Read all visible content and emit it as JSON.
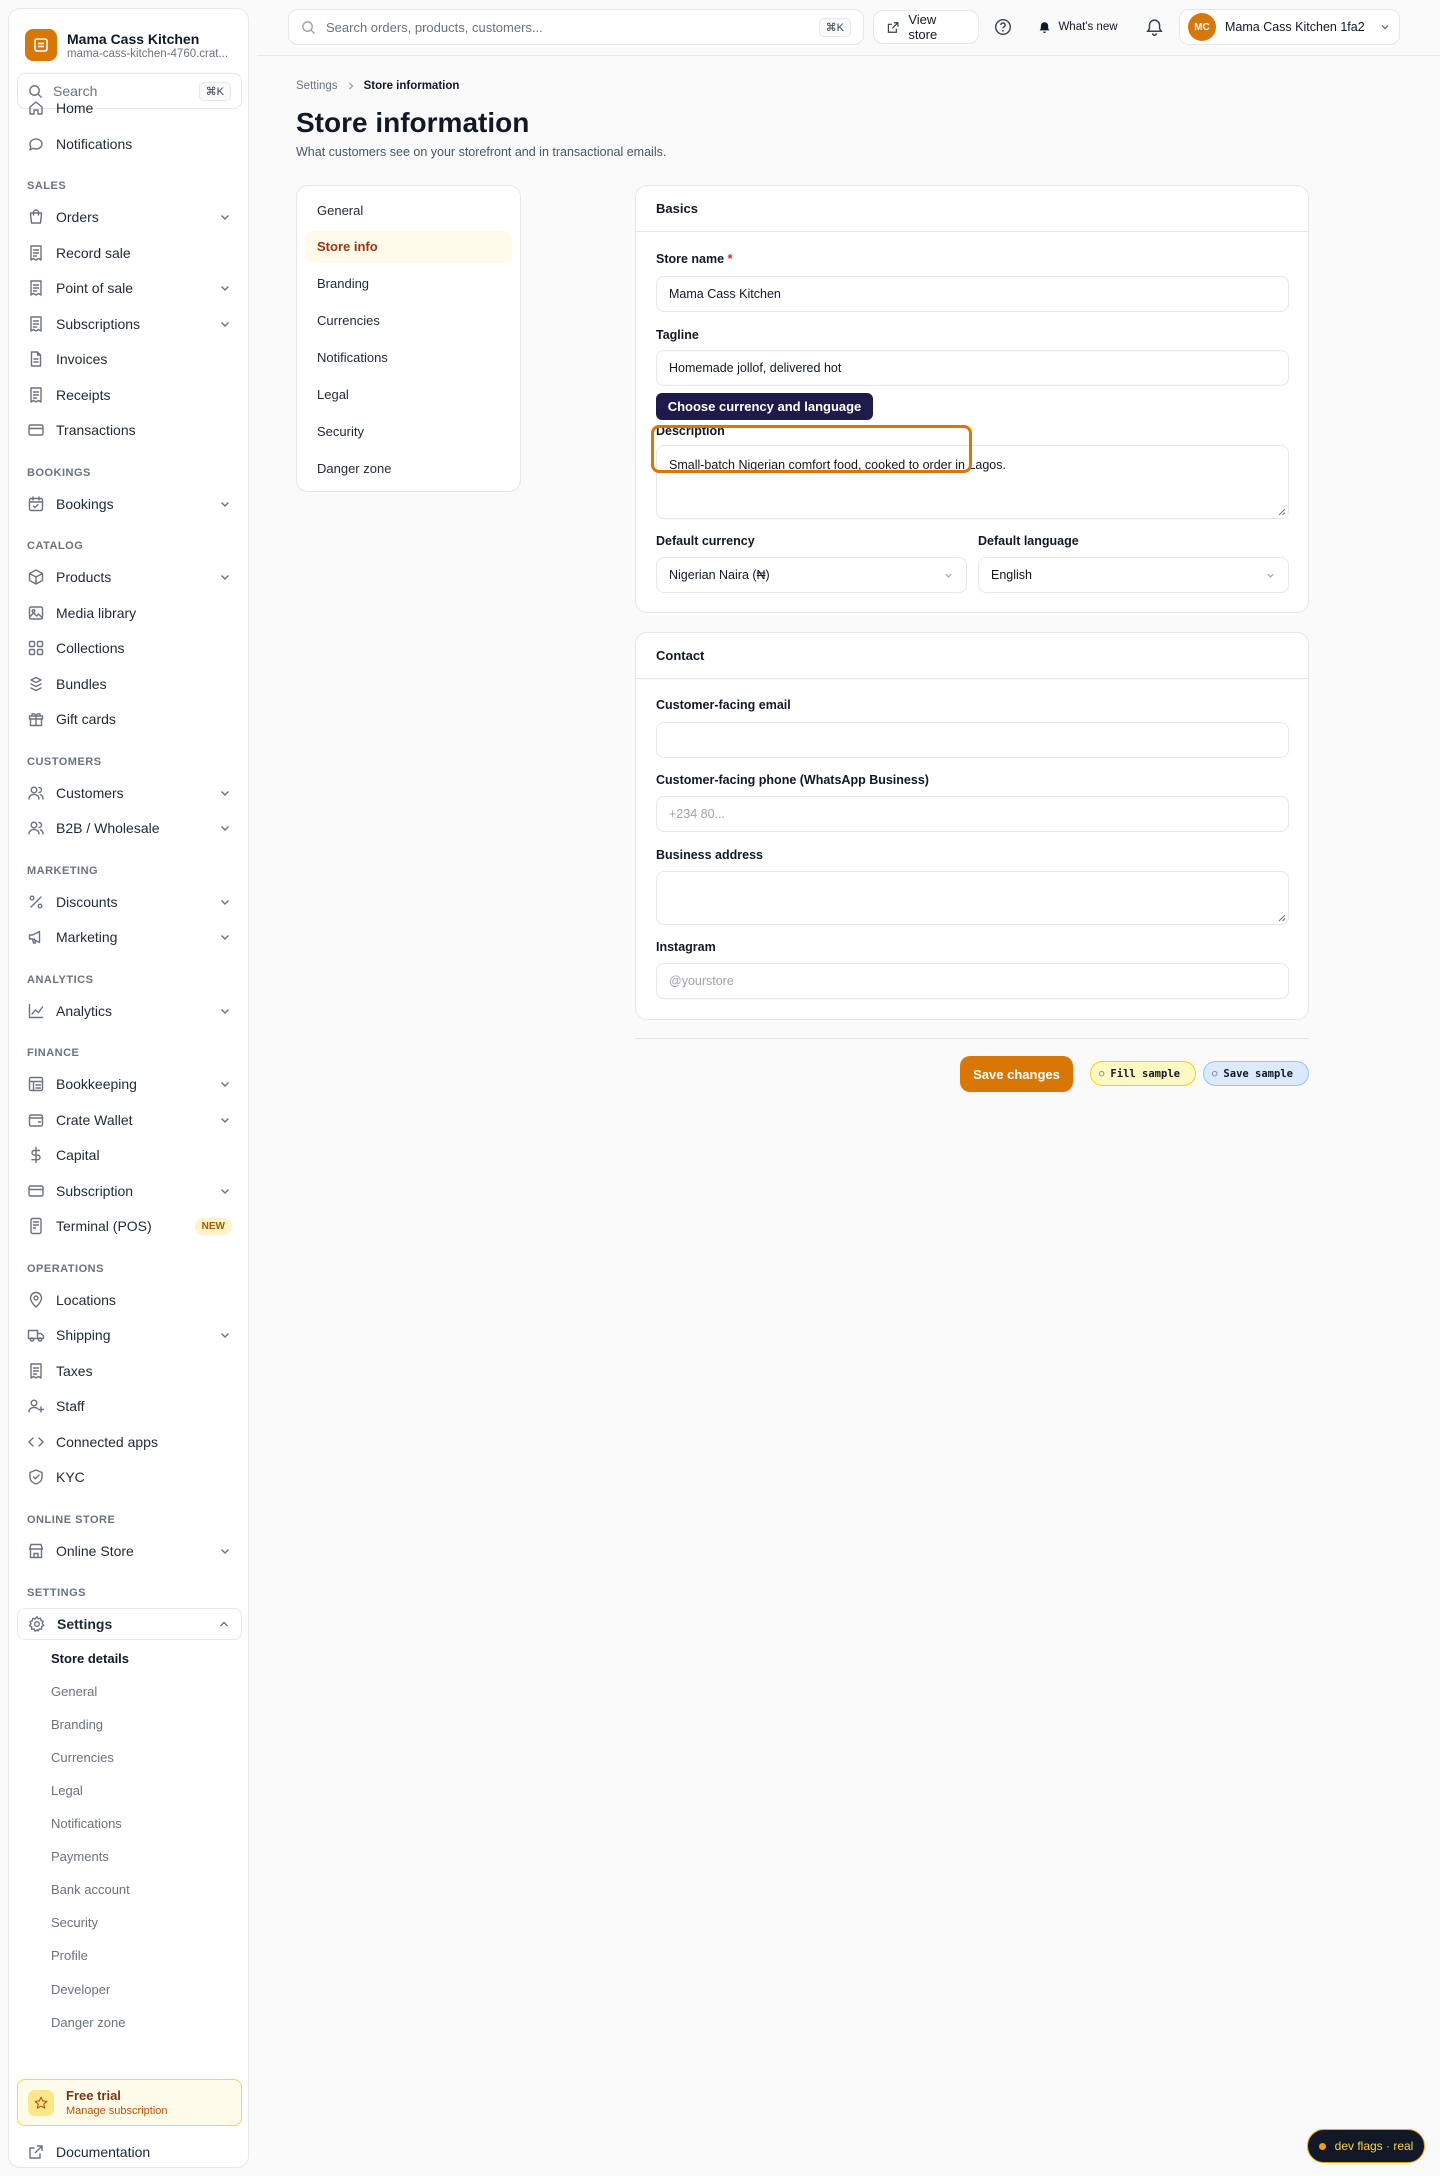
{
  "brand": {
    "name": "Mama Cass Kitchen",
    "subdomain": "mama-cass-kitchen-4760.crat..."
  },
  "sidebar": {
    "search": {
      "label": "Search",
      "shortcut": "⌘K"
    },
    "top_items": [
      {
        "label": "Home",
        "icon": "home-icon"
      },
      {
        "label": "Notifications",
        "icon": "chat-bubble-icon"
      }
    ],
    "sections": [
      {
        "title": "SALES",
        "items": [
          {
            "label": "Orders",
            "icon": "bag-icon",
            "expandable": true
          },
          {
            "label": "Record sale",
            "icon": "receipt-icon",
            "expandable": false
          },
          {
            "label": "Point of sale",
            "icon": "receipt-icon",
            "expandable": true
          },
          {
            "label": "Subscriptions",
            "icon": "receipt-icon",
            "expandable": true
          },
          {
            "label": "Invoices",
            "icon": "document-icon",
            "expandable": false
          },
          {
            "label": "Receipts",
            "icon": "receipt-icon",
            "expandable": false
          },
          {
            "label": "Transactions",
            "icon": "card-icon",
            "expandable": false
          }
        ]
      },
      {
        "title": "BOOKINGS",
        "items": [
          {
            "label": "Bookings",
            "icon": "calendar-icon",
            "expandable": true
          }
        ]
      },
      {
        "title": "CATALOG",
        "items": [
          {
            "label": "Products",
            "icon": "box-icon",
            "expandable": true
          },
          {
            "label": "Media library",
            "icon": "image-icon",
            "expandable": false
          },
          {
            "label": "Collections",
            "icon": "grid-icon",
            "expandable": false
          },
          {
            "label": "Bundles",
            "icon": "bundle-icon",
            "expandable": false
          },
          {
            "label": "Gift cards",
            "icon": "gift-icon",
            "expandable": false
          }
        ]
      },
      {
        "title": "CUSTOMERS",
        "items": [
          {
            "label": "Customers",
            "icon": "users-icon",
            "expandable": true
          },
          {
            "label": "B2B / Wholesale",
            "icon": "users-icon",
            "expandable": true
          }
        ]
      },
      {
        "title": "MARKETING",
        "items": [
          {
            "label": "Discounts",
            "icon": "percent-icon",
            "expandable": true
          },
          {
            "label": "Marketing",
            "icon": "megaphone-icon",
            "expandable": true
          }
        ]
      },
      {
        "title": "ANALYTICS",
        "items": [
          {
            "label": "Analytics",
            "icon": "chart-line-icon",
            "expandable": true
          }
        ]
      },
      {
        "title": "FINANCE",
        "items": [
          {
            "label": "Bookkeeping",
            "icon": "ledger-icon",
            "expandable": true
          },
          {
            "label": "Crate Wallet",
            "icon": "wallet-icon",
            "expandable": true
          },
          {
            "label": "Capital",
            "icon": "dollar-icon",
            "expandable": false
          },
          {
            "label": "Subscription",
            "icon": "card-icon",
            "expandable": true
          },
          {
            "label": "Terminal (POS)",
            "icon": "terminal-icon",
            "expandable": false,
            "badge": "NEW"
          }
        ]
      },
      {
        "title": "OPERATIONS",
        "items": [
          {
            "label": "Locations",
            "icon": "pin-icon",
            "expandable": false
          },
          {
            "label": "Shipping",
            "icon": "truck-icon",
            "expandable": true
          },
          {
            "label": "Taxes",
            "icon": "receipt-icon",
            "expandable": false
          },
          {
            "label": "Staff",
            "icon": "user-plus-icon",
            "expandable": false
          },
          {
            "label": "Connected apps",
            "icon": "code-icon",
            "expandable": false
          },
          {
            "label": "KYC",
            "icon": "shield-icon",
            "expandable": false
          }
        ]
      },
      {
        "title": "ONLINE STORE",
        "items": [
          {
            "label": "Online Store",
            "icon": "store-icon",
            "expandable": true
          }
        ]
      },
      {
        "title": "SETTINGS",
        "items": [
          {
            "label": "Settings",
            "icon": "gear-icon",
            "expandable": true,
            "expanded": true
          }
        ]
      }
    ],
    "settings_sub": [
      "Store details",
      "General",
      "Branding",
      "Currencies",
      "Legal",
      "Notifications",
      "Payments",
      "Bank account",
      "Security",
      "Profile",
      "Developer",
      "Danger zone"
    ],
    "trial": {
      "title": "Free trial",
      "subtitle": "Manage subscription"
    },
    "documentation": "Documentation"
  },
  "topbar": {
    "search_placeholder": "Search orders, products, customers...",
    "search_shortcut": "⌘K",
    "view_store": "View store",
    "whats_new": "What's new",
    "account_initials": "MC",
    "account_name": "Mama Cass Kitchen 1fa2"
  },
  "page": {
    "breadcrumb": [
      "Settings",
      "Store information"
    ],
    "title": "Store information",
    "subtitle": "What customers see on your storefront and in transactional emails.",
    "subnav": [
      "General",
      "Store info",
      "Branding",
      "Currencies",
      "Notifications",
      "Legal",
      "Security",
      "Danger zone"
    ],
    "subnav_active": "Store info"
  },
  "basics": {
    "title": "Basics",
    "store_name_label": "Store name",
    "store_name_required": "*",
    "store_name_value": "Mama Cass Kitchen",
    "tagline_label": "Tagline",
    "tagline_value": "Homemade jollof, delivered hot",
    "description_label": "Description",
    "description_value": "Small-batch Nigerian comfort food, cooked to order in Lagos.",
    "currency_label": "Default currency",
    "currency_value": "Nigerian Naira (₦)",
    "language_label": "Default language",
    "language_value": "English"
  },
  "tooltip": "Choose currency and language",
  "contact": {
    "title": "Contact",
    "email_label": "Customer-facing email",
    "email_value": "",
    "phone_label": "Customer-facing phone (WhatsApp Business)",
    "phone_placeholder": "+234 80...",
    "address_label": "Business address",
    "address_value": "",
    "instagram_label": "Instagram",
    "instagram_placeholder": "@yourstore"
  },
  "actions": {
    "save": "Save changes",
    "fill_sample": "Fill sample",
    "save_sample": "Save sample"
  },
  "dev_flags": "dev flags · real",
  "colors": {
    "accent": "#d97706",
    "tooltip_bg": "#1e1b4b",
    "active_bg": "#fffbeb"
  }
}
